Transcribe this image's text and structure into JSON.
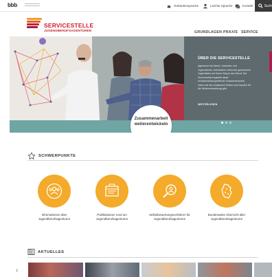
{
  "topbar": {
    "logo_text": "bbb",
    "links": [
      {
        "label": "Gebärdensprache",
        "icon": "sign-language-icon"
      },
      {
        "label": "Leichte Sprache",
        "icon": "easy-language-icon"
      },
      {
        "label": "Kontakt",
        "icon": "contact-icon"
      }
    ],
    "search_label": "Such"
  },
  "header": {
    "brand_title": "SERVICESTELLE",
    "brand_subtitle": "JUGENDBERUFSAGENTUREN",
    "nav": [
      "GRUNDLAGEN",
      "PRAXIS",
      "SERVICE"
    ]
  },
  "hero": {
    "caption": [
      "Zusammenarbeit",
      "weiterentwickeln"
    ],
    "panel_title": "ÜBER DIE SERVICESTELLE",
    "panel_text": "Agenturen für Arbeit, Jobcenter und Jugendämter unterstützen vielerorts gemeinsam Jugendliche auf ihrem Weg in den Beruf. Die Servicestelle begleitet diese rechtskreisübergreifende Zusammenarbeit, indem sie den Austausch fördert und Impulse für die Weiterentwicklung gibt.",
    "panel_more": "WEITERLESEN",
    "slide_count": 3,
    "active_slide": 1
  },
  "schwerpunkte": {
    "title": "SCHWERPUNKTE",
    "tiles": [
      {
        "label": [
          "Informationen über",
          "Jugendberufsagenturen"
        ],
        "icon": "people-circle-icon"
      },
      {
        "label": [
          "Publikationen rund um",
          "Jugendberufsagenturen"
        ],
        "icon": "publications-icon"
      },
      {
        "label": [
          "Selbstbewertungsverfahren für",
          "Jugendberufsagenturen"
        ],
        "icon": "magnifier-person-icon"
      },
      {
        "label": [
          "Bundesweite Übersicht aller",
          "Jugendberufsagenturen"
        ],
        "icon": "germany-map-icon"
      }
    ]
  },
  "aktuelles": {
    "title": "AKTUELLES"
  },
  "colors": {
    "brand_red": "#c8202d",
    "accent_orange": "#f4aa2a",
    "panel_gray": "#5e6a6e",
    "teal": "#6fa5a3"
  }
}
